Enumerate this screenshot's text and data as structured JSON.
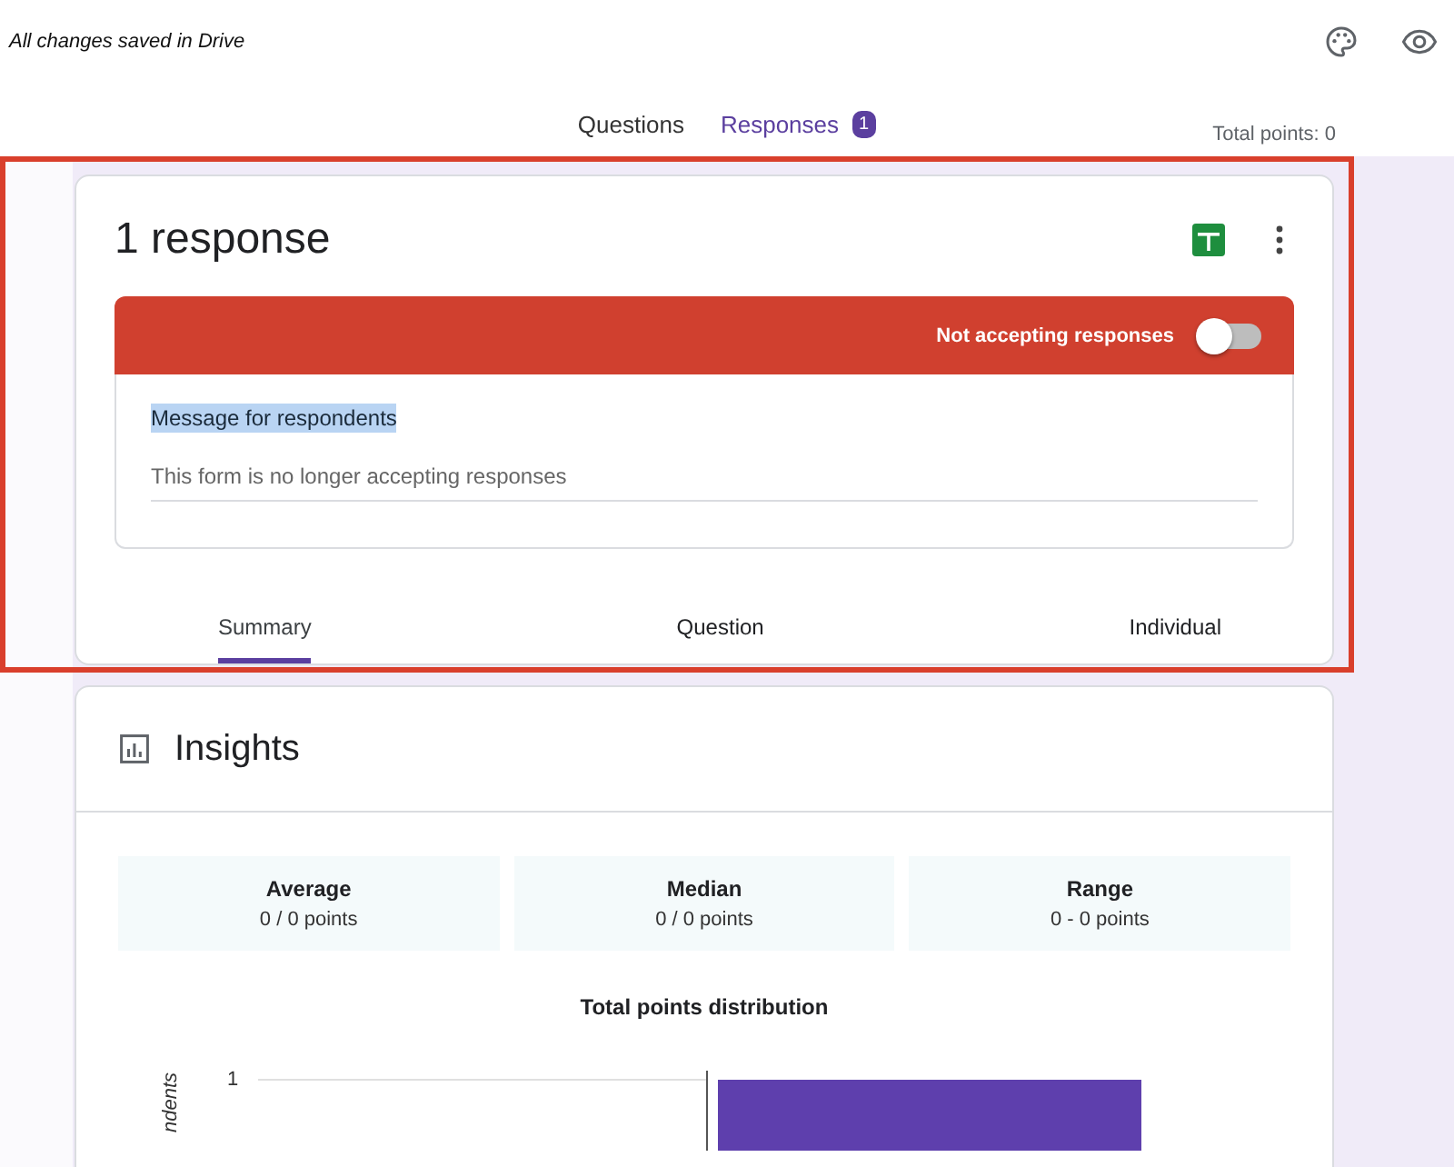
{
  "header": {
    "save_status": "All changes saved in Drive",
    "tabs": [
      {
        "label": "Questions",
        "selected": false
      },
      {
        "label": "Responses",
        "selected": true,
        "badge": "1"
      }
    ],
    "total_points": "Total points: 0"
  },
  "responses_card": {
    "title": "1 response",
    "banner": {
      "label": "Not accepting responses",
      "on": false
    },
    "message": {
      "label": "Message for respondents",
      "value": "This form is no longer accepting responses"
    },
    "tabs": [
      {
        "label": "Summary",
        "selected": true
      },
      {
        "label": "Question",
        "selected": false
      },
      {
        "label": "Individual",
        "selected": false
      }
    ]
  },
  "insights": {
    "title": "Insights",
    "stats": [
      {
        "label": "Average",
        "value": "0 / 0 points"
      },
      {
        "label": "Median",
        "value": "0 / 0 points"
      },
      {
        "label": "Range",
        "value": "0 - 0 points"
      }
    ],
    "chart": {
      "title": "Total points distribution",
      "ytick": "1",
      "ylabel": "ndents"
    }
  }
}
